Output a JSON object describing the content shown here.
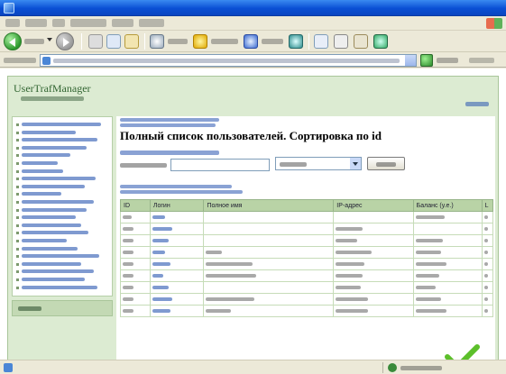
{
  "page": {
    "title": "Полный список пользователей. Сортировка по id"
  },
  "table": {
    "columns": [
      "ID",
      "Логин",
      "Полное имя",
      "IP-адрес",
      "Баланс (у.е.)",
      "L"
    ],
    "row_count": 9
  },
  "colors": {
    "titlebar": "#0a4fd4",
    "frame_background": "#dcebd2",
    "table_header": "#b9d3a6",
    "link": "#2a56b0"
  },
  "icons": {
    "back": "back-arrow-icon",
    "forward": "forward-arrow-icon",
    "go": "go-arrow-icon",
    "zone": "internet-zone-icon",
    "check": "checkmark-icon"
  }
}
